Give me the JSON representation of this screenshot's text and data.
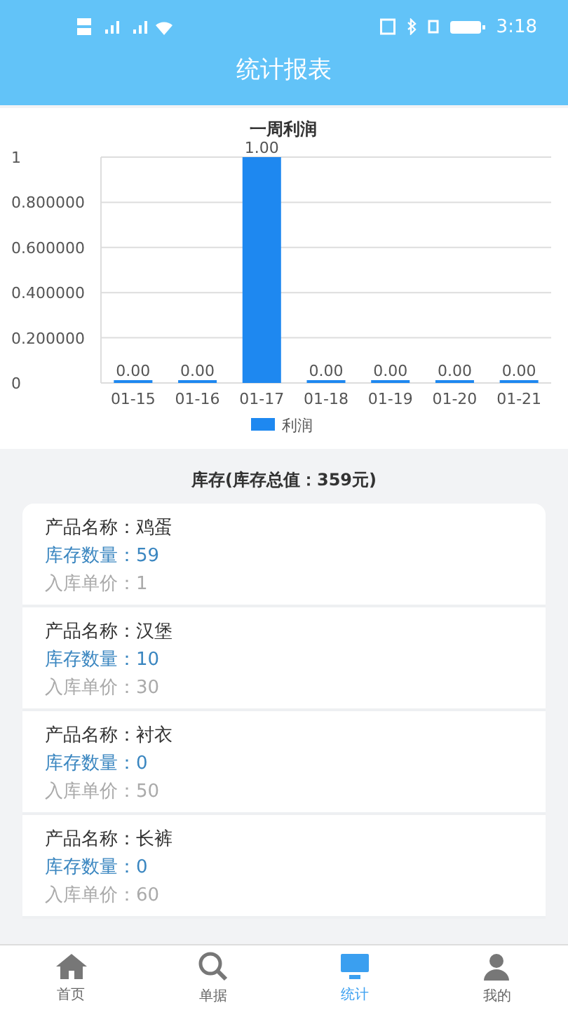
{
  "status_bar": {
    "time": "3:18"
  },
  "header": {
    "title": "统计报表"
  },
  "chart": {
    "chart_data": {
      "type": "bar",
      "title": "一周利润",
      "categories": [
        "01-15",
        "01-16",
        "01-17",
        "01-18",
        "01-19",
        "01-20",
        "01-21"
      ],
      "series": [
        {
          "name": "利润",
          "color": "#1e88f0",
          "values": [
            0,
            0,
            1,
            0,
            0,
            0,
            0
          ]
        }
      ],
      "ylim": [
        0,
        1
      ],
      "grid": true,
      "yticks": [
        {
          "value": 0,
          "label": "0"
        },
        {
          "value": 0.2,
          "label": "0.200000"
        },
        {
          "value": 0.4,
          "label": "0.400000"
        },
        {
          "value": 0.6,
          "label": "0.600000"
        },
        {
          "value": 0.8,
          "label": "0.800000"
        },
        {
          "value": 1,
          "label": "1"
        }
      ],
      "value_labels": [
        "0.00",
        "0.00",
        "1.00",
        "0.00",
        "0.00",
        "0.00",
        "0.00"
      ]
    }
  },
  "inventory": {
    "title": "库存(库存总值：359元)",
    "items": [
      {
        "name_label": "产品名称：",
        "name": "鸡蛋",
        "qty_label": "库存数量：",
        "qty": "59",
        "price_label": "入库单价：",
        "price": "1"
      },
      {
        "name_label": "产品名称：",
        "name": "汉堡",
        "qty_label": "库存数量：",
        "qty": "10",
        "price_label": "入库单价：",
        "price": "30"
      },
      {
        "name_label": "产品名称：",
        "name": "衬衣",
        "qty_label": "库存数量：",
        "qty": "0",
        "price_label": "入库单价：",
        "price": "50"
      },
      {
        "name_label": "产品名称：",
        "name": "长裤",
        "qty_label": "库存数量：",
        "qty": "0",
        "price_label": "入库单价：",
        "price": "60"
      }
    ]
  },
  "tab_bar": [
    {
      "label": "首页",
      "kind": "home",
      "selected": false
    },
    {
      "label": "单据",
      "kind": "search",
      "selected": false
    },
    {
      "label": "统计",
      "kind": "stats",
      "selected": true
    },
    {
      "label": "我的",
      "kind": "user",
      "selected": false
    }
  ]
}
